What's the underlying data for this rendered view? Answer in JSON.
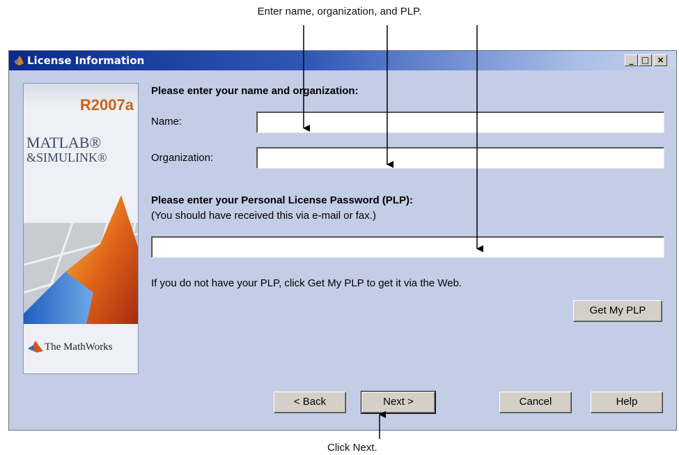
{
  "annotations": {
    "top": "Enter name, organization, and PLP.",
    "bottom": "Click Next."
  },
  "window": {
    "title": "License Information",
    "controls": {
      "minimize": "_",
      "maximize": "□",
      "close": "×"
    }
  },
  "splash": {
    "release": "R2007a",
    "product_line1": "MATLAB®",
    "product_line2": "&SIMULINK®",
    "company": "The MathWorks"
  },
  "form": {
    "name_section_heading": "Please enter your name and organization:",
    "name_label": "Name:",
    "name_value": "",
    "organization_label": "Organization:",
    "organization_value": "",
    "plp_heading": "Please enter your Personal License Password (PLP):",
    "plp_subtext": "(You should have received this via e-mail or fax.)",
    "plp_value": "",
    "plp_help_text": "If you do not have your PLP, click Get My PLP to get it via the Web.",
    "get_plp_label": "Get My PLP"
  },
  "footer": {
    "back_label": "< Back",
    "next_label": "Next >",
    "cancel_label": "Cancel",
    "help_label": "Help"
  },
  "colors": {
    "window_bg": "#c3cde6",
    "title_gradient_start": "#0a2a8c",
    "button_face": "#d4d0c8",
    "release_accent": "#c8641a"
  }
}
